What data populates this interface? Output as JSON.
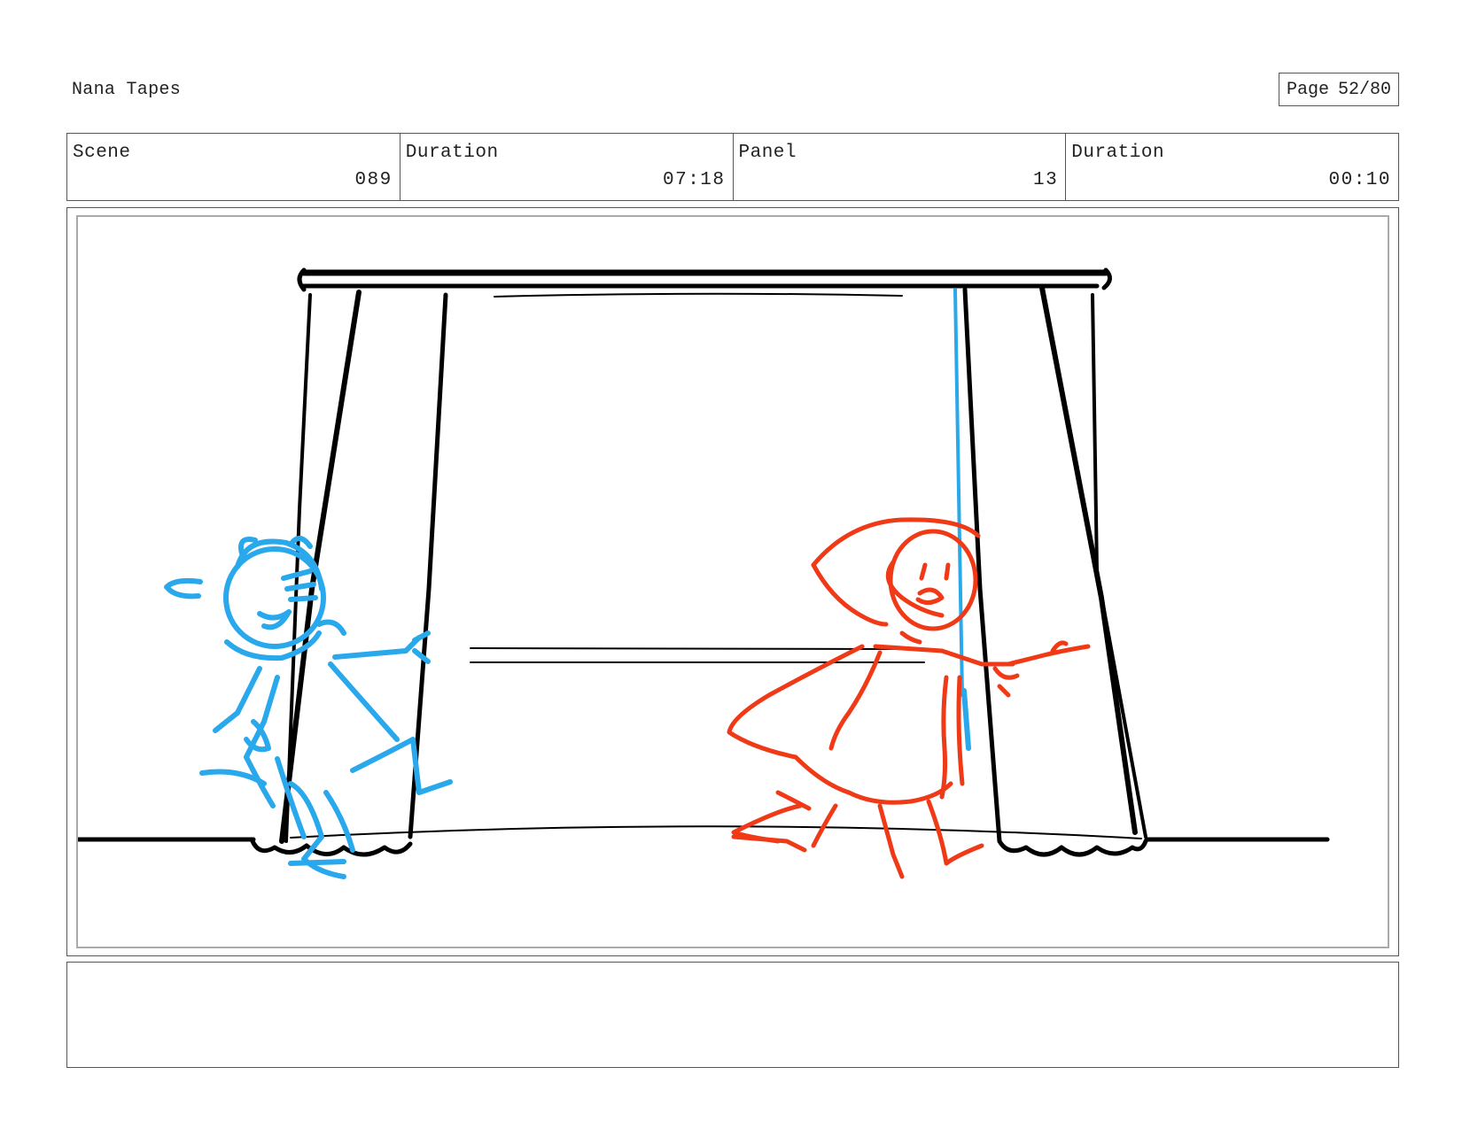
{
  "header": {
    "project_title": "Nana Tapes",
    "page_label": "Page",
    "page_value": "52/80"
  },
  "info": {
    "scene_label": "Scene",
    "scene_value": "089",
    "scene_duration_label": "Duration",
    "scene_duration_value": "07:18",
    "panel_label": "Panel",
    "panel_value": "13",
    "panel_duration_label": "Duration",
    "panel_duration_value": "00:10"
  },
  "notes": {
    "text": ""
  },
  "colors": {
    "blue_character": "#29a8ec",
    "red_character": "#f03a17",
    "ink": "#000000"
  }
}
